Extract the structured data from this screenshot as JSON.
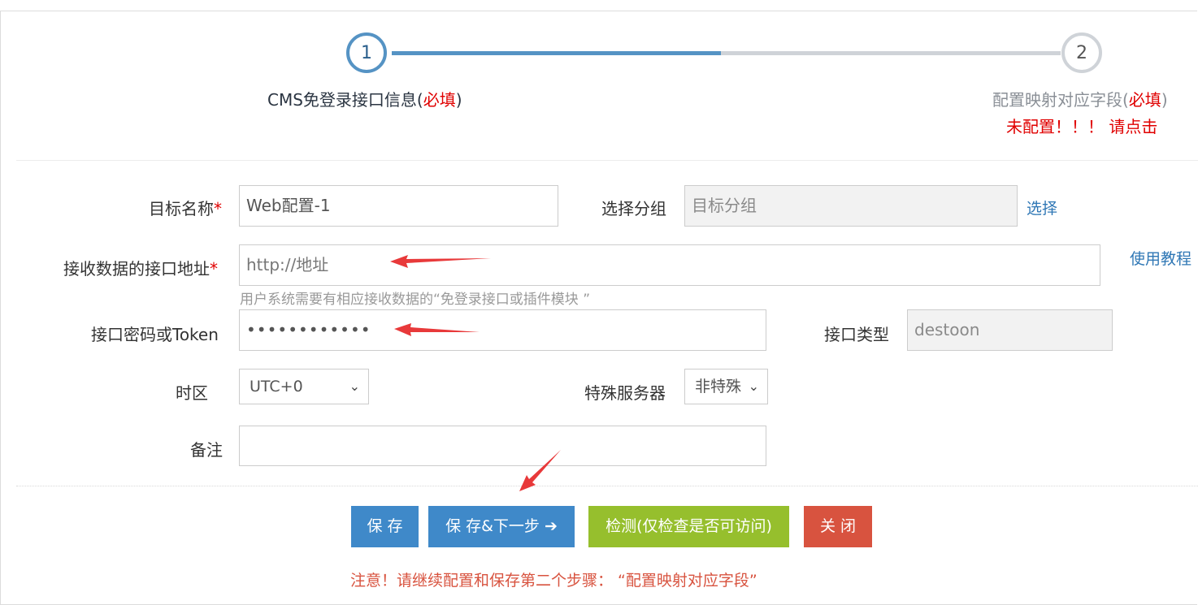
{
  "steps": [
    {
      "number": "1",
      "label": "CMS免登录接口信息(",
      "required": "必填",
      "close": ")"
    },
    {
      "number": "2",
      "label": "配置映射对应字段(",
      "required": "必填",
      "close": ")",
      "warning": "未配置！！！ 请点击"
    }
  ],
  "form": {
    "target_name": {
      "label": "目标名称",
      "required_mark": "*",
      "value": "Web配置-1"
    },
    "group": {
      "label": "选择分组",
      "placeholder": "目标分组",
      "action": "选择"
    },
    "api_url": {
      "label": "接收数据的接口地址",
      "required_mark": "*",
      "value": "http://地址",
      "help": "用户系统需要有相应接收数据的“免登录接口或插件模块 ”",
      "tutorial": "使用教程"
    },
    "token": {
      "label": "接口密码或Token",
      "value": "••••••••••••"
    },
    "api_type": {
      "label": "接口类型",
      "value": "destoon"
    },
    "timezone": {
      "label": "时区",
      "value": "UTC+0"
    },
    "special_server": {
      "label": "特殊服务器",
      "value": "非特殊"
    },
    "remark": {
      "label": "备注",
      "value": ""
    }
  },
  "buttons": {
    "save": "保 存",
    "save_next": "保 存&下一步",
    "save_next_icon": "➔",
    "check": "检测(仅检查是否可访问)",
    "close": "关 闭"
  },
  "note": "注意！请继续配置和保存第二个步骤：  “配置映射对应字段”",
  "colors": {
    "primary": "#3f89c9",
    "step_active": "#5593c4",
    "required": "#e00000",
    "check": "#96bf2d",
    "danger": "#d8533f"
  }
}
